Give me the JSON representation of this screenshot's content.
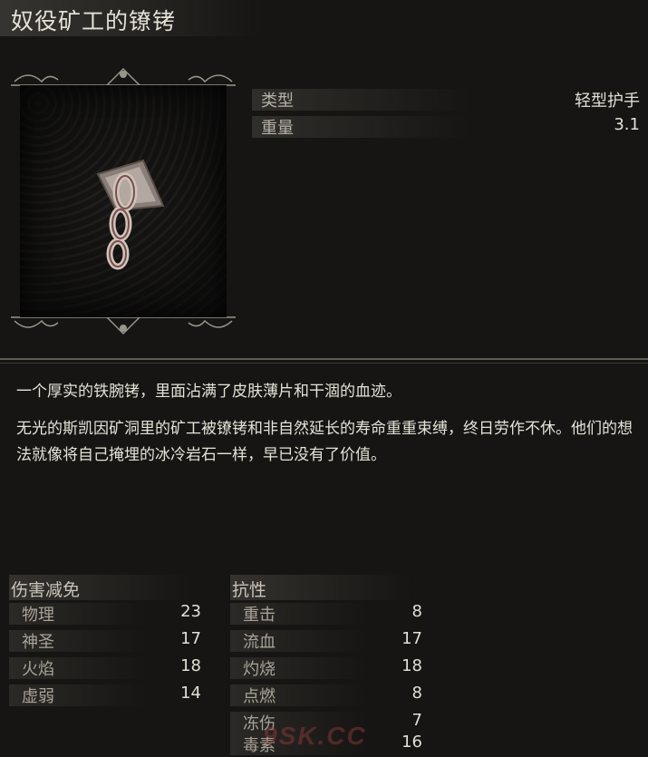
{
  "item": {
    "name": "奴役矿工的镣铐",
    "stats": [
      {
        "label": "类型",
        "value": "轻型护手"
      },
      {
        "label": "重量",
        "value": "3.1"
      }
    ],
    "description": [
      "一个厚实的铁腕铐，里面沾满了皮肤薄片和干涸的血迹。",
      "无光的斯凯因矿洞里的矿工被镣铐和非自然延长的寿命重重束缚，终日劳作不休。他们的想法就像将自己掩埋的冰冷岩石一样，早已没有了价值。"
    ]
  },
  "damage_reduction": {
    "title": "伤害减免",
    "rows": [
      {
        "label": "物理",
        "value": "23"
      },
      {
        "label": "神圣",
        "value": "17"
      },
      {
        "label": "火焰",
        "value": "18"
      },
      {
        "label": "虚弱",
        "value": "14"
      }
    ]
  },
  "resistance": {
    "title": "抗性",
    "rows": [
      {
        "label": "重击",
        "value": "8"
      },
      {
        "label": "流血",
        "value": "17"
      },
      {
        "label": "灼烧",
        "value": "18"
      },
      {
        "label": "点燃",
        "value": "8"
      },
      {
        "label": "冻伤",
        "value": "7"
      },
      {
        "label": "毒素",
        "value": "16"
      }
    ]
  },
  "watermark": "9SK.CC",
  "icons": {
    "item_image": "shackle-icon",
    "frame": "ornate-frame"
  }
}
